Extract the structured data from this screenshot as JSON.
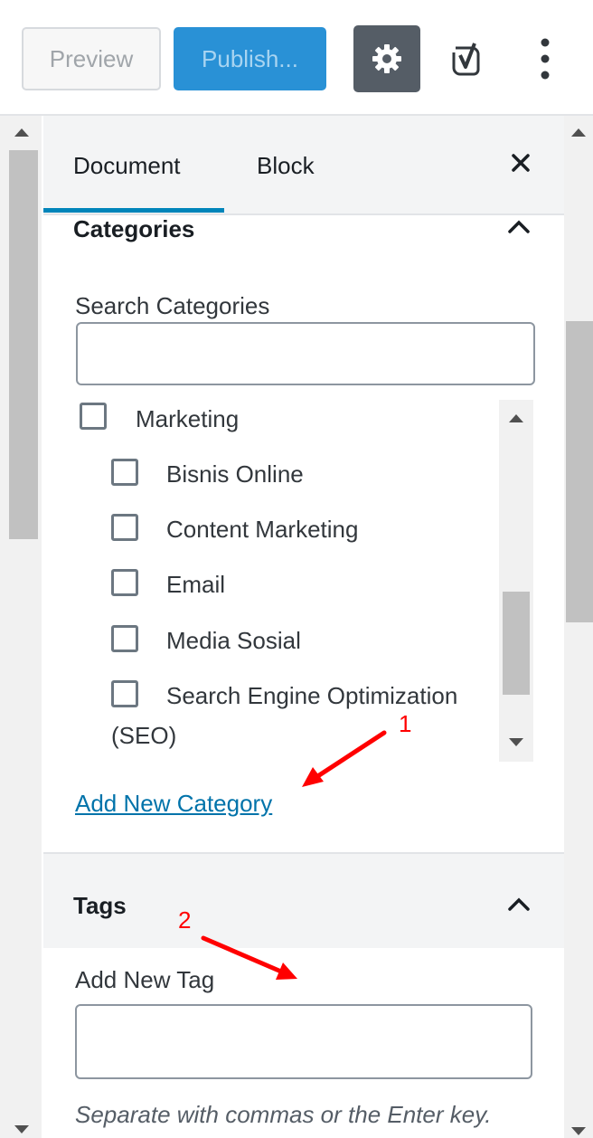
{
  "toolbar": {
    "preview_label": "Preview",
    "publish_label": "Publish...",
    "settings_icon": "gear-icon",
    "yoast_icon": "yoast-icon",
    "more_icon": "more-vertical-icon"
  },
  "sidebar": {
    "tabs": [
      {
        "label": "Document",
        "active": true
      },
      {
        "label": "Block",
        "active": false
      }
    ],
    "close_icon": "close-icon",
    "categories": {
      "title": "Categories",
      "search_label": "Search Categories",
      "search_value": "",
      "items": [
        {
          "label": "Marketing",
          "checked": false
        },
        {
          "label": "Bisnis Online",
          "checked": false
        },
        {
          "label": "Content Marketing",
          "checked": false
        },
        {
          "label": "Email",
          "checked": false
        },
        {
          "label": "Media Sosial",
          "checked": false
        },
        {
          "label": "Search Engine Optimization",
          "label_cont": "(SEO)",
          "checked": false
        }
      ],
      "add_new_label": "Add New Category"
    },
    "tags": {
      "title": "Tags",
      "add_label": "Add New Tag",
      "add_value": "",
      "hint": "Separate with commas or the Enter key."
    }
  },
  "annotations": [
    {
      "label": "1",
      "color": "#ff0000"
    },
    {
      "label": "2",
      "color": "#ff0000"
    }
  ],
  "colors": {
    "accent": "#0085ba",
    "publish": "#2991d6",
    "link": "#0073aa",
    "annotation": "#ff0000"
  }
}
